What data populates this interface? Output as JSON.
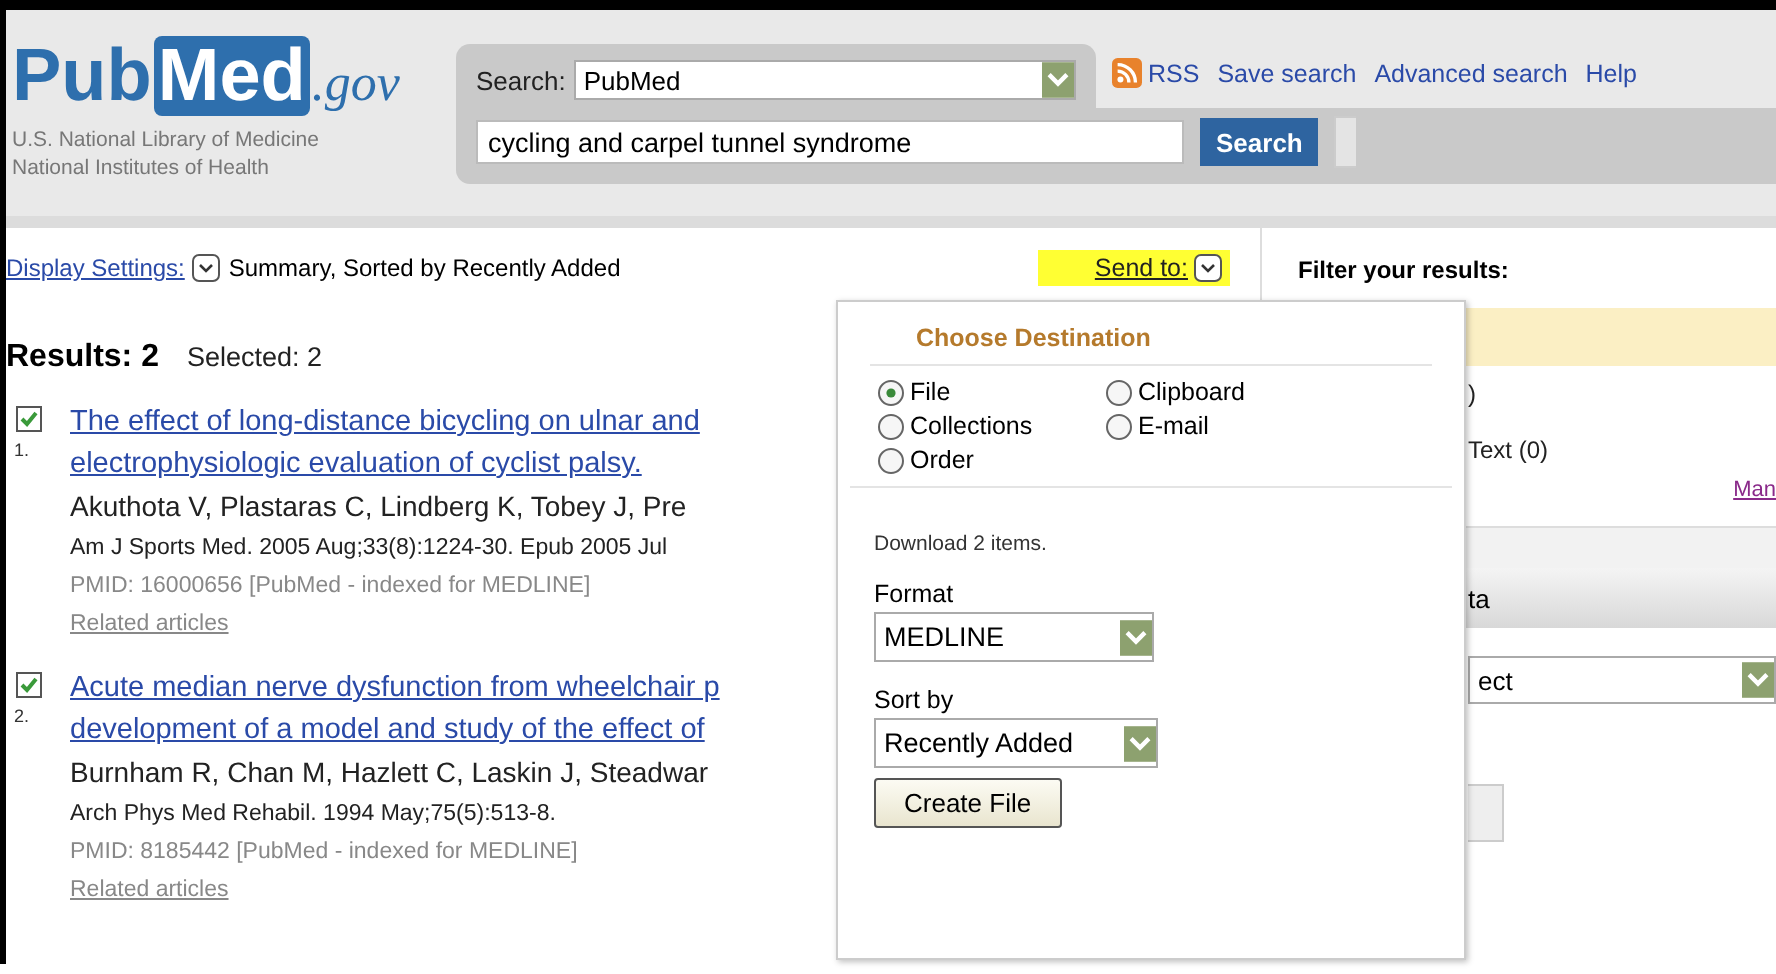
{
  "logo": {
    "part1": "Pub",
    "part2": "Med",
    "suffix": ".gov"
  },
  "agency": [
    "U.S. National Library of Medicine",
    "National Institutes of Health"
  ],
  "search": {
    "label": "Search:",
    "database": "PubMed",
    "query": "cycling and carpel tunnel syndrome",
    "button": "Search"
  },
  "links": [
    {
      "label": "RSS",
      "kind": "rss"
    },
    {
      "label": "Save search",
      "kind": "link"
    },
    {
      "label": "Advanced search",
      "kind": "link"
    },
    {
      "label": "Help",
      "kind": "link"
    }
  ],
  "display_settings": {
    "link": "Display Settings:",
    "value": "Summary, Sorted by Recently Added"
  },
  "send_to": {
    "label": "Send to:",
    "expanded": true
  },
  "results": {
    "title": "Results: 2",
    "selected": "Selected: 2",
    "items": [
      {
        "number": "1.",
        "checked": true,
        "title_lines": [
          "The effect of long-distance bicycling on ulnar and",
          "electrophysiologic evaluation of cyclist palsy."
        ],
        "authors": "Akuthota V, Plastaras C, Lindberg K, Tobey J, Pre",
        "citation": "Am J Sports Med. 2005 Aug;33(8):1224-30. Epub 2005 Jul",
        "pmid": "PMID: 16000656 [PubMed - indexed for MEDLINE]",
        "related": "Related articles"
      },
      {
        "number": "2.",
        "checked": true,
        "title_lines": [
          "Acute median nerve dysfunction from wheelchair p",
          "development of a model and study of the effect of"
        ],
        "authors": "Burnham R, Chan M, Hazlett C, Laskin J, Steadwar",
        "citation": "Arch Phys Med Rehabil. 1994 May;75(5):513-8.",
        "pmid": "PMID: 8185442 [PubMed - indexed for MEDLINE]",
        "related": "Related articles"
      }
    ]
  },
  "filter": {
    "title": "Filter your results:",
    "lines": [
      ")",
      "Text (0)"
    ],
    "manage": "Man",
    "panel_header": "ta",
    "select": "ect"
  },
  "send_to_menu": {
    "title": "Choose Destination",
    "destinations": [
      {
        "label": "File",
        "selected": true
      },
      {
        "label": "Clipboard",
        "selected": false
      },
      {
        "label": "Collections",
        "selected": false
      },
      {
        "label": "E-mail",
        "selected": false
      },
      {
        "label": "Order",
        "selected": false
      }
    ],
    "note": "Download 2 items.",
    "format_label": "Format",
    "format": "MEDLINE",
    "sort_label": "Sort by",
    "sort": "Recently Added",
    "button": "Create File"
  }
}
